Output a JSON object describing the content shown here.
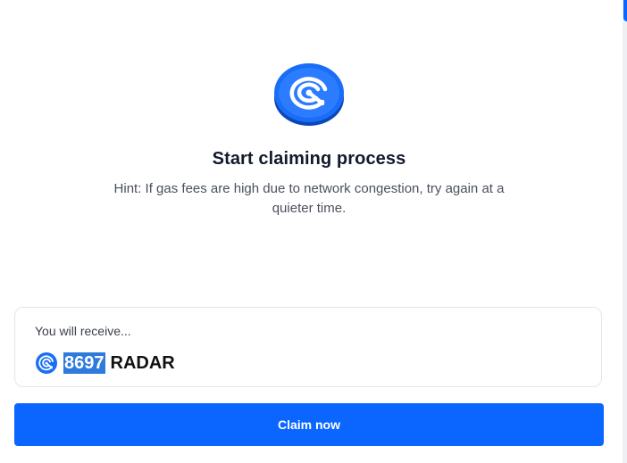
{
  "header": {
    "logo_icon": "radar-coin-icon",
    "title": "Start claiming process",
    "hint": "Hint: If gas fees are high due to network congestion, try again at a quieter time."
  },
  "receive": {
    "label": "You will receive...",
    "token_icon": "radar-token-icon",
    "amount": "8697",
    "symbol": "RADAR"
  },
  "actions": {
    "claim_label": "Claim now"
  },
  "colors": {
    "accent": "#0a66ff",
    "title": "#121a2b",
    "selection": "#2f7bdc"
  }
}
